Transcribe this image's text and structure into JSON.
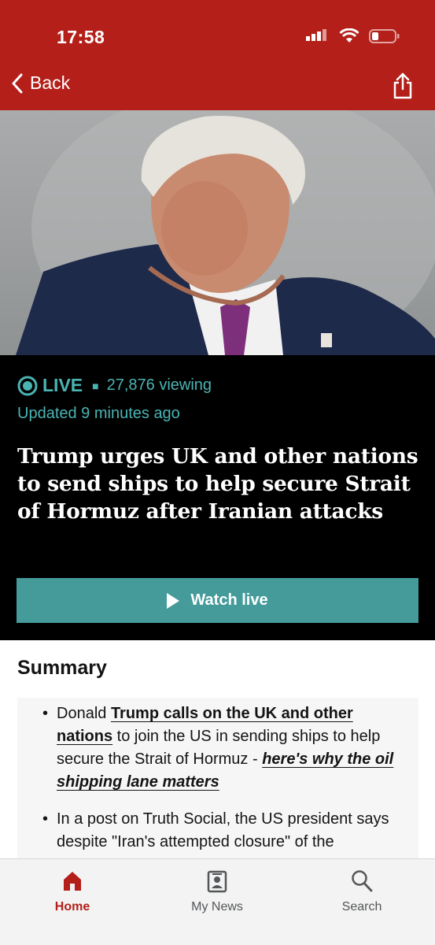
{
  "status_bar": {
    "time": "17:58"
  },
  "nav": {
    "back_label": "Back"
  },
  "live": {
    "live_label": "LIVE",
    "viewers": "27,876 viewing",
    "updated": "Updated 9 minutes ago",
    "headline": "Trump urges UK and other nations to send ships to help secure Strait of Hormuz after Iranian attacks",
    "watch_label": "Watch live"
  },
  "summary": {
    "title": "Summary",
    "item1": {
      "pre": "Donald ",
      "link1": "Trump calls on the UK and other nations",
      "mid": " to join the US in sending ships to help secure the Strait of Hormuz - ",
      "link2": "here's why the oil shipping lane matters"
    },
    "item2": "In a post on Truth Social, the US president says despite \"Iran's attempted closure\" of the"
  },
  "tabs": [
    {
      "label": "Home",
      "icon": "home-icon",
      "active": true
    },
    {
      "label": "My News",
      "icon": "my-news-icon",
      "active": false
    },
    {
      "label": "Search",
      "icon": "search-icon",
      "active": false
    }
  ],
  "colors": {
    "brand_red": "#b41f1a",
    "live_teal": "#4ab4b3",
    "watch_button": "#449b9a"
  }
}
